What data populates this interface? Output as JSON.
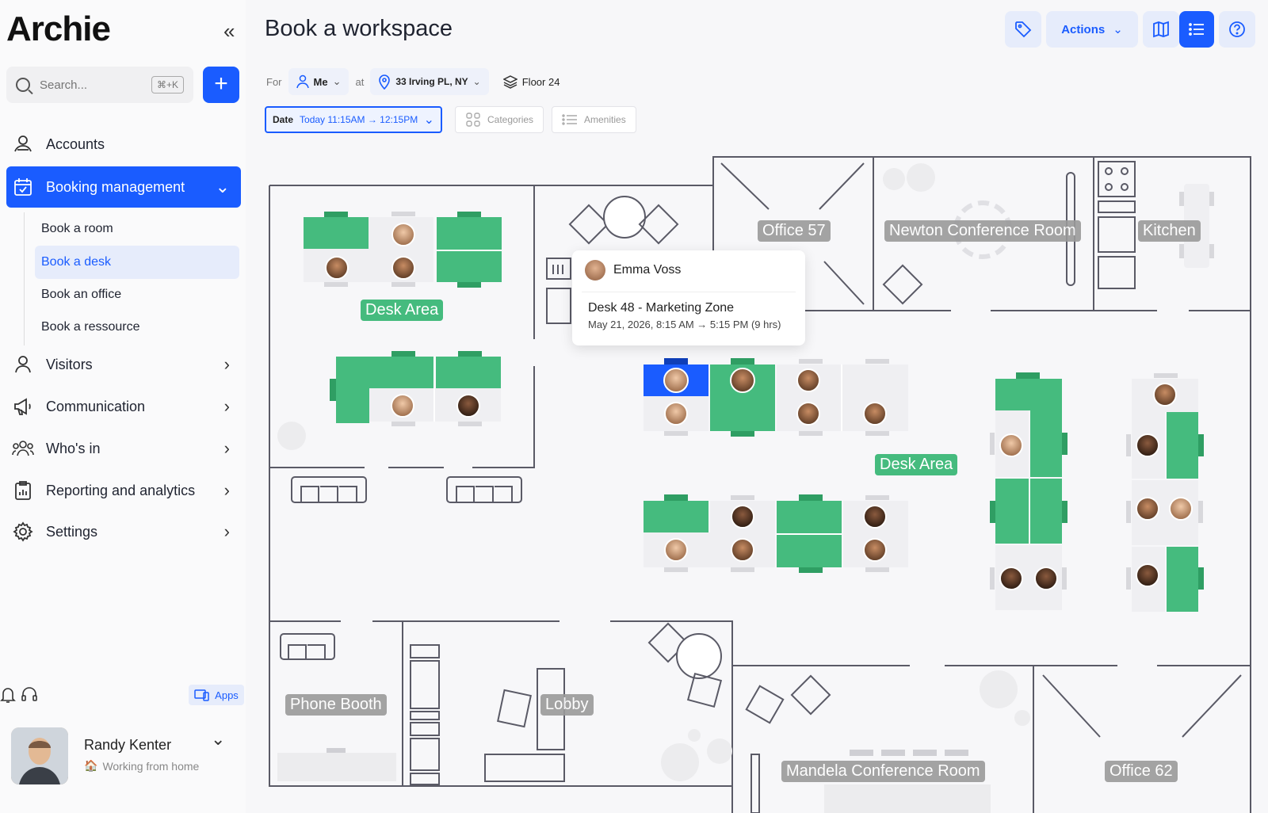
{
  "app": {
    "logo": "Archie"
  },
  "sidebar": {
    "search_placeholder": "Search...",
    "search_shortcut": "⌘+K",
    "nav": [
      {
        "label": "Accounts"
      },
      {
        "label": "Booking management",
        "active": true
      },
      {
        "label": "Visitors"
      },
      {
        "label": "Communication"
      },
      {
        "label": "Who's in"
      },
      {
        "label": "Reporting and analytics"
      },
      {
        "label": "Settings"
      }
    ],
    "booking_subitems": [
      {
        "label": "Book a room"
      },
      {
        "label": "Book a desk",
        "selected": true
      },
      {
        "label": "Book an office"
      },
      {
        "label": "Book a ressource"
      }
    ],
    "apps_label": "Apps",
    "user": {
      "name": "Randy Kenter",
      "status": "Working from home"
    }
  },
  "header": {
    "title": "Book a workspace",
    "actions_label": "Actions"
  },
  "filters": {
    "for_label": "For",
    "for_value": "Me",
    "at_label": "at",
    "location": "33 Irving PL, NY",
    "floor": "Floor 24",
    "date_label": "Date",
    "date_value": "Today 11:15AM → 12:15PM",
    "categories": "Categories",
    "amenities": "Amenities"
  },
  "map": {
    "rooms": [
      {
        "label": "Office 57"
      },
      {
        "label": "Newton Conference Room"
      },
      {
        "label": "Kitchen"
      },
      {
        "label": "Phone Booth"
      },
      {
        "label": "Lobby"
      },
      {
        "label": "Mandela Conference Room"
      },
      {
        "label": "Office 62"
      }
    ],
    "zones": [
      {
        "label": "Desk Area"
      },
      {
        "label": "Desk Area"
      }
    ]
  },
  "tooltip": {
    "name": "Emma Voss",
    "desk": "Desk 48 - Marketing Zone",
    "time": "May 21, 2026, 8:15 AM → 5:15 PM (9 hrs)"
  },
  "colors": {
    "accent": "#1a5cff",
    "desk_green": "#45bb7e",
    "selected_desk": "#1a5cff",
    "room_label": "#9a9a9a"
  }
}
